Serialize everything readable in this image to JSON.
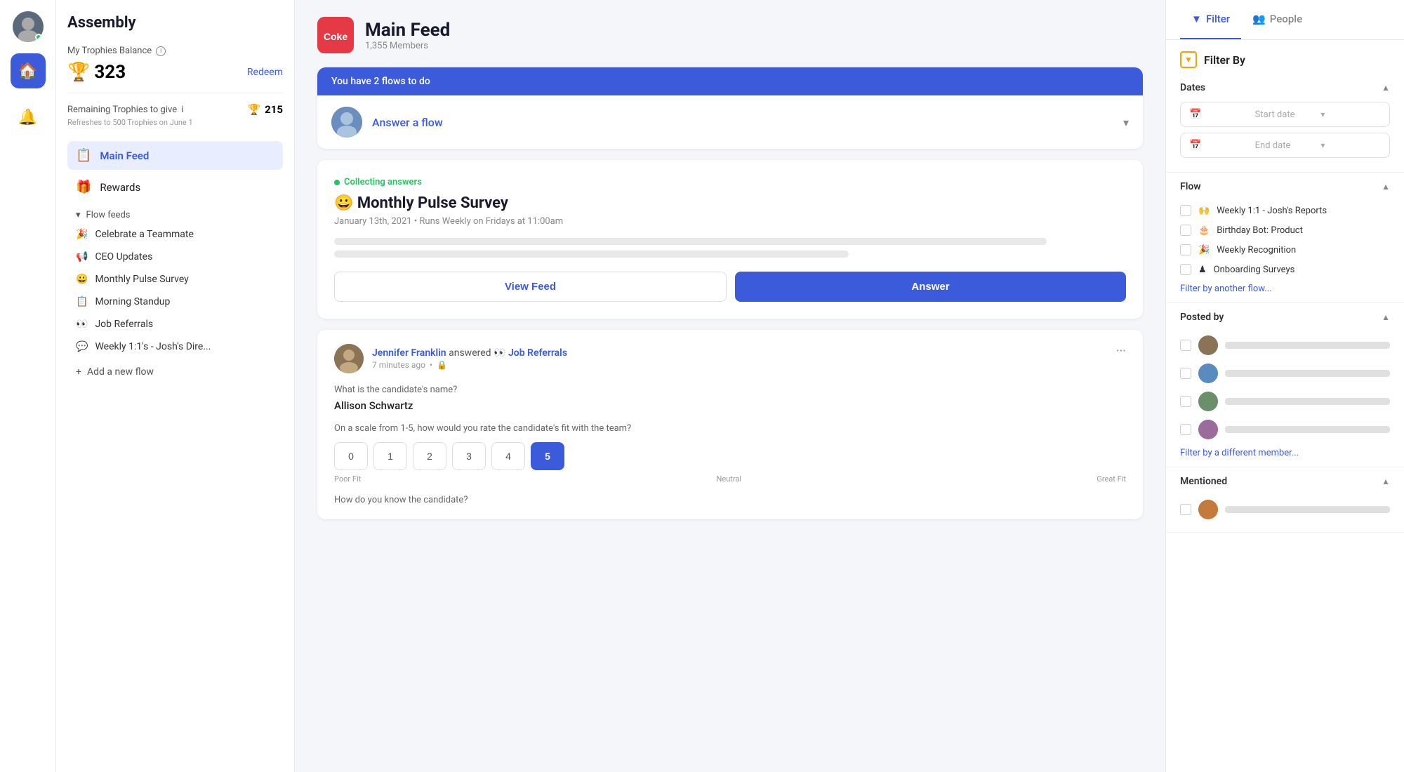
{
  "iconBar": {
    "homeIcon": "🏠",
    "bellIcon": "🔔"
  },
  "sidebar": {
    "brand": "Assembly",
    "trophiesLabel": "My Trophies Balance",
    "trophiesCount": "323",
    "redeemLabel": "Redeem",
    "remainingLabel": "Remaining Trophies to give",
    "remainingRefresh": "Refreshes to 500 Trophies on June 1",
    "remainingCount": "215",
    "navItems": [
      {
        "icon": "📋",
        "label": "Main Feed",
        "active": true
      },
      {
        "icon": "🎁",
        "label": "Rewards",
        "active": false
      }
    ],
    "flowFeedsLabel": "Flow feeds",
    "flowFeeds": [
      {
        "icon": "🎉",
        "label": "Celebrate a Teammate"
      },
      {
        "icon": "📢",
        "label": "CEO Updates"
      },
      {
        "icon": "😀",
        "label": "Monthly Pulse Survey"
      },
      {
        "icon": "📋",
        "label": "Morning Standup"
      },
      {
        "icon": "👀",
        "label": "Job Referrals"
      },
      {
        "icon": "💬",
        "label": "Weekly 1:1's - Josh's Dire..."
      }
    ],
    "addFlowLabel": "Add a new flow"
  },
  "feedHeader": {
    "logoText": "Coke",
    "title": "Main Feed",
    "members": "1,355 Members"
  },
  "todoBanner": "You have 2 flows to do",
  "answerFlowLabel": "Answer a flow",
  "survey": {
    "collectingLabel": "Collecting answers",
    "emoji": "😀",
    "title": "Monthly Pulse Survey",
    "meta": "January 13th, 2021 • Runs Weekly on Fridays at 11:00am",
    "viewFeedLabel": "View Feed",
    "answerLabel": "Answer"
  },
  "post": {
    "authorName": "Jennifer Franklin",
    "action": "answered",
    "flowIcon": "👀",
    "flowName": "Job Referrals",
    "timeAgo": "7 minutes ago",
    "question1": "What is the candidate's name?",
    "answer1": "Allison Schwartz",
    "question2": "On a scale from 1-5, how would you rate the candidate's fit with the team?",
    "ratings": [
      "0",
      "1",
      "2",
      "3",
      "4",
      "5"
    ],
    "selectedRating": 5,
    "ratingLabelLeft": "Poor Fit",
    "ratingLabelMid": "Neutral",
    "ratingLabelRight": "Great Fit",
    "question3": "How do you know the candidate?"
  },
  "rightPanel": {
    "filterTabLabel": "Filter",
    "peopleTabLabel": "People",
    "filterByLabel": "Filter By",
    "datesLabel": "Dates",
    "startDatePlaceholder": "Start date",
    "endDatePlaceholder": "End date",
    "flowLabel": "Flow",
    "flowItems": [
      {
        "icon": "🙌",
        "label": "Weekly 1:1 - Josh's Reports"
      },
      {
        "icon": "🎂",
        "label": "Birthday Bot: Product"
      },
      {
        "icon": "🎉",
        "label": "Weekly Recognition"
      },
      {
        "icon": "♟",
        "label": "Onboarding Surveys"
      }
    ],
    "filterAnotherFlowLabel": "Filter by another flow...",
    "postedByLabel": "Posted by",
    "filterDifferentMemberLabel": "Filter by a different member...",
    "mentionedLabel": "Mentioned"
  }
}
